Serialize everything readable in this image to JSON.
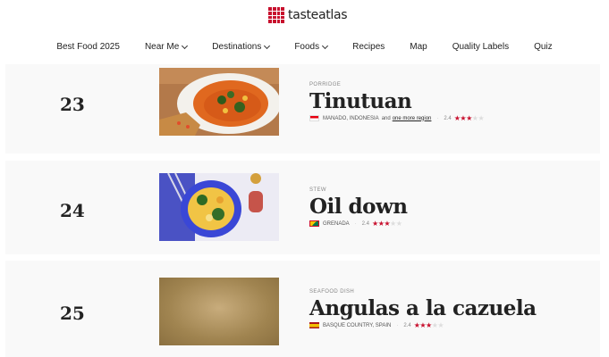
{
  "header": {
    "logo_text": "tasteatlas",
    "brand_color": "#c8102e"
  },
  "nav": {
    "items": [
      {
        "label": "Best Food 2025",
        "dropdown": false
      },
      {
        "label": "Near Me",
        "dropdown": true
      },
      {
        "label": "Destinations",
        "dropdown": true
      },
      {
        "label": "Foods",
        "dropdown": true
      },
      {
        "label": "Recipes",
        "dropdown": false
      },
      {
        "label": "Map",
        "dropdown": false
      },
      {
        "label": "Quality Labels",
        "dropdown": false
      },
      {
        "label": "Quiz",
        "dropdown": false
      }
    ]
  },
  "list": {
    "items": [
      {
        "rank": "23",
        "category": "PORRIDGE",
        "name": "Tinutuan",
        "location": "MANADO, INDONESIA",
        "and_text": "and",
        "more_link": "one more region",
        "score": "2.4",
        "stars_full": 2,
        "stars_half": 1,
        "stars_empty": 2,
        "image": "porridge-bowl-photo"
      },
      {
        "rank": "24",
        "category": "STEW",
        "name": "Oil down",
        "location": "GRENADA",
        "score": "2.4",
        "stars_full": 2,
        "stars_half": 1,
        "stars_empty": 2,
        "image": "stew-plate-photo"
      },
      {
        "rank": "25",
        "category": "SEAFOOD DISH",
        "name": "Angulas a la cazuela",
        "location": "BASQUE COUNTRY, SPAIN",
        "score": "2.4",
        "stars_full": 2,
        "stars_half": 1,
        "stars_empty": 2,
        "image": "image-placeholder"
      }
    ]
  }
}
